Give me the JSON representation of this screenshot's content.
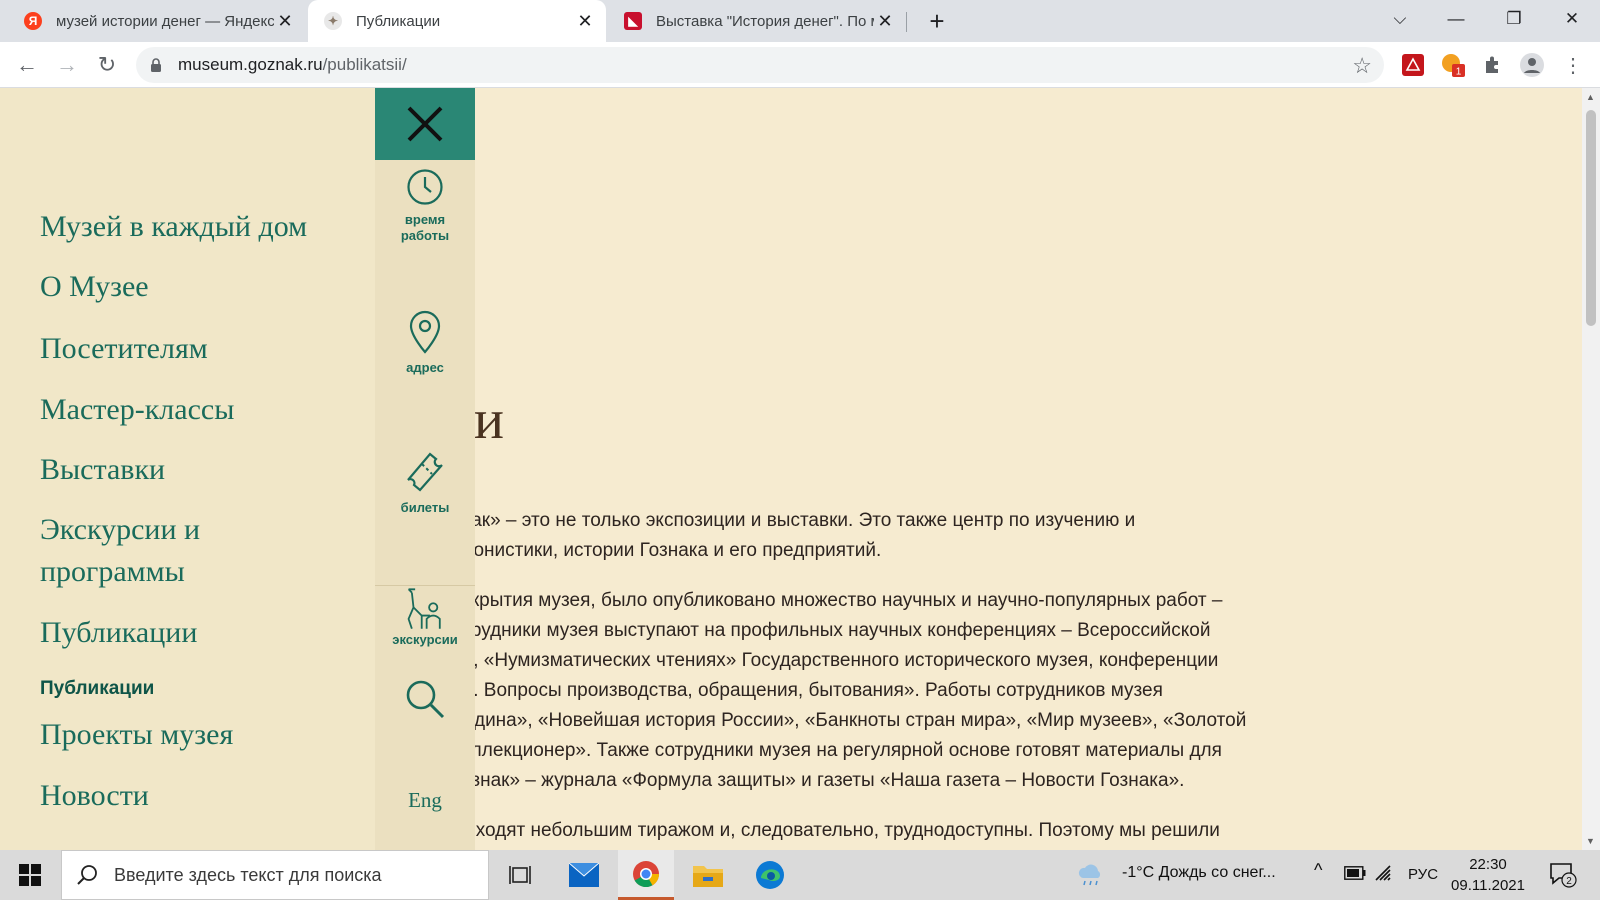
{
  "browser": {
    "tabs": [
      {
        "title": "музей истории денег — Яндекс",
        "active": false,
        "favicon": "yandex-icon"
      },
      {
        "title": "Публикации",
        "active": true,
        "favicon": "goznak-icon"
      },
      {
        "title": "Выставка \"История денег\". По м",
        "active": false,
        "favicon": "museum-icon"
      }
    ],
    "url_host": "museum.goznak.ru",
    "url_path": "/publikatsii/",
    "extension_badge": "1"
  },
  "page": {
    "heading_visible": "ии",
    "paragraphs": [
      [
        "знак» – это не только экспозиции и выставки. Это также центр по изучению и",
        ", бонистики, истории Гознака и его предприятий."
      ],
      [
        "открытия музея, было опубликовано множество научных и научно-популярных работ –",
        "отрудники музея выступают на профильных научных конференциях – Всероссийской",
        "ии, «Нумизматических чтениях» Государственного исторического музея, конференции",
        "ии. Вопросы производства, обращения, бытования». Работы сотрудников музея",
        "Родина», «Новейшая история России», «Банкноты стран мира», «Мир музеев», «Золотой",
        "коллекционер». Также сотрудники музея на регулярной основе готовят материалы для",
        "Гознак» – журнала «Формула защиты» и газеты «Наша газета – Новости Гознака»."
      ],
      [
        "выходят небольшим тиражом и, следовательно, труднодоступны. Поэтому мы решили"
      ]
    ]
  },
  "menu": {
    "items": [
      "Музей в каждый дом",
      "О Музее",
      "Посетителям",
      "Мастер-классы",
      "Выставки",
      "Экскурсии и",
      "программы",
      "Публикации",
      "Проекты музея",
      "Новости"
    ],
    "sub_item": "Публикации"
  },
  "rail": {
    "hours_label_1": "время",
    "hours_label_2": "работы",
    "address_label": "адрес",
    "tickets_label": "билеты",
    "excursions_label": "экскурсии",
    "lang": "Eng"
  },
  "taskbar": {
    "search_placeholder": "Введите здесь текст для поиска",
    "weather": "-1°C  Дождь со снег...",
    "lang": "РУС",
    "time": "22:30",
    "date": "09.11.2021",
    "notifications": "2"
  },
  "colors": {
    "accent": "#2a8775",
    "menu_text": "#1a6b5b",
    "page_bg": "#f6ebd0"
  }
}
